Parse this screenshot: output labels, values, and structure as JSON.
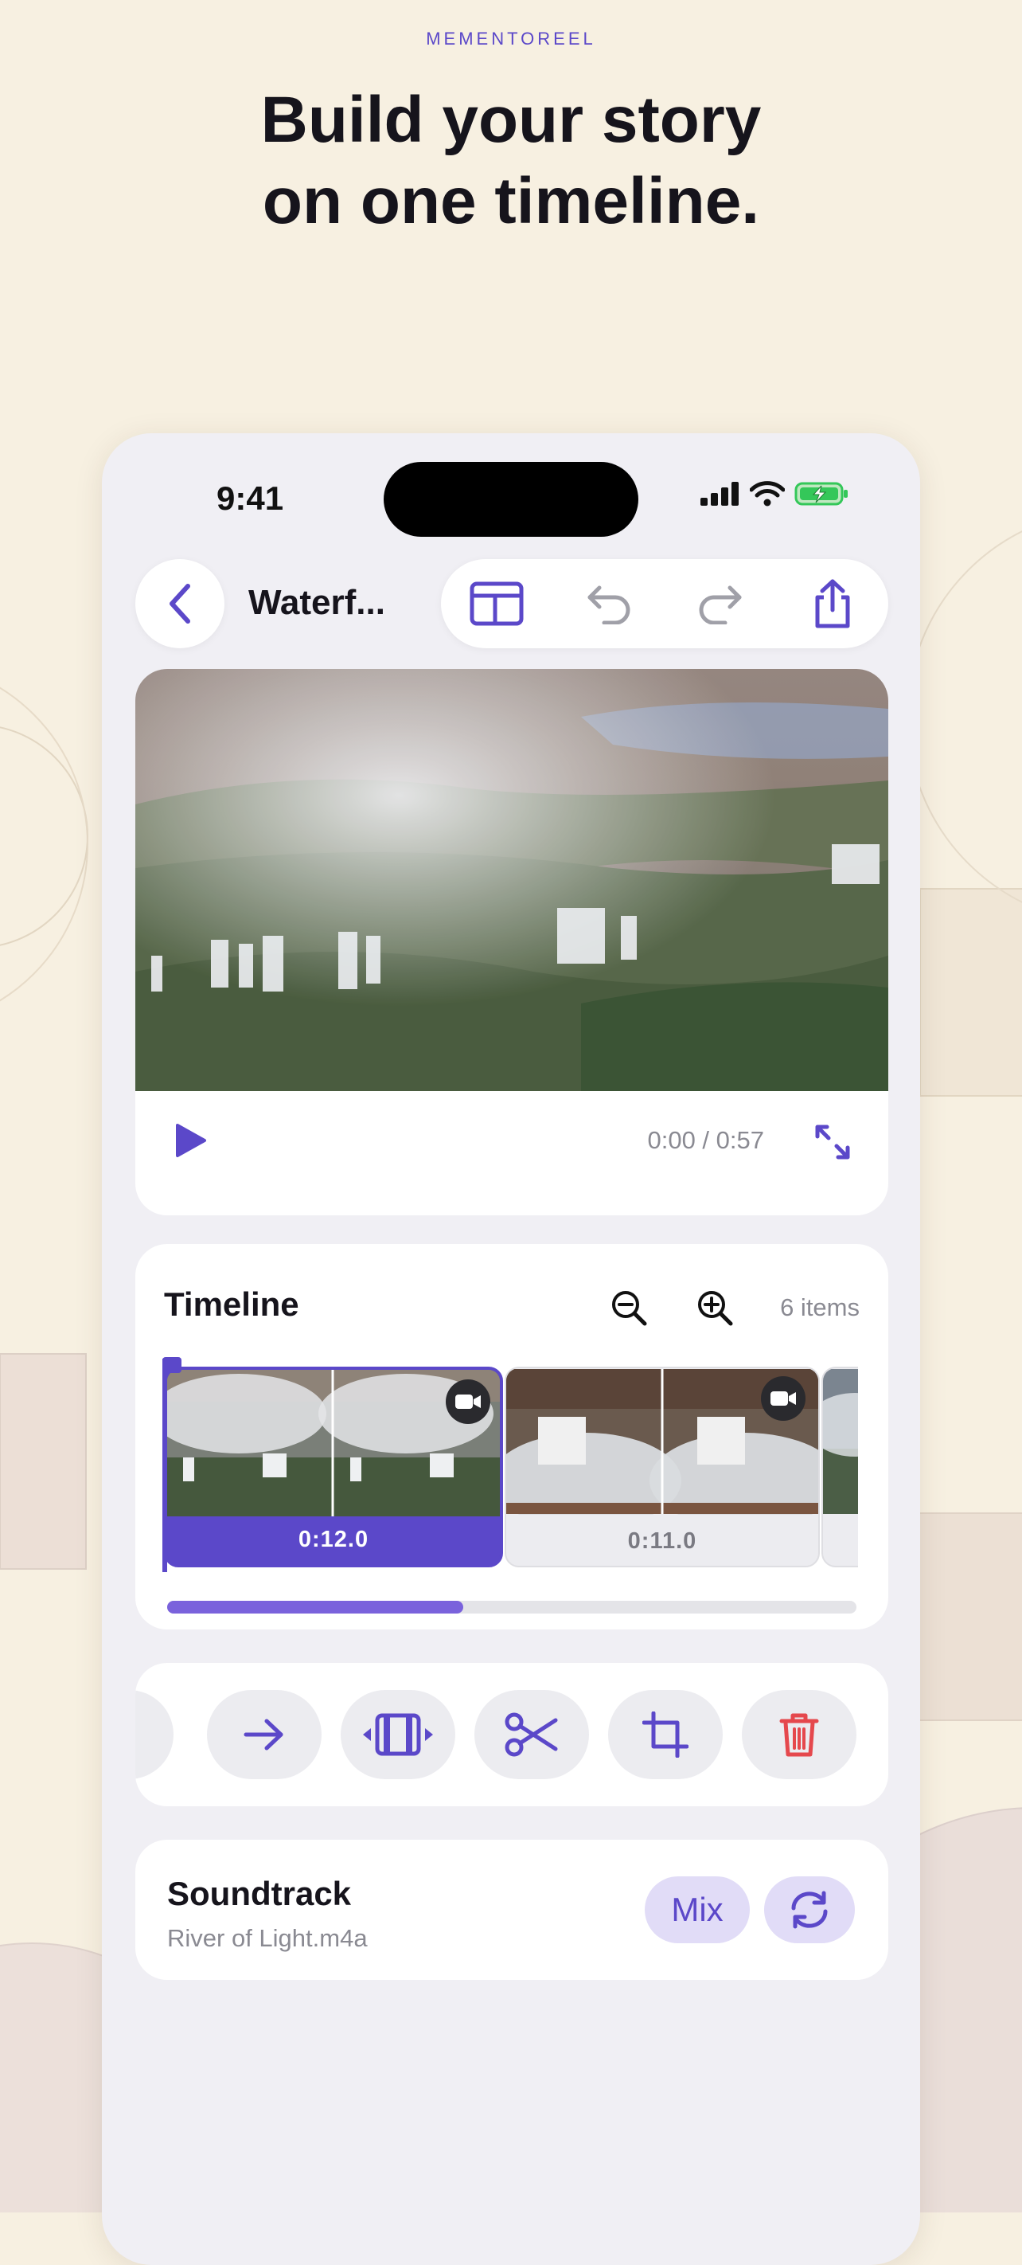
{
  "brand": "MEMENTOREEL",
  "headline": {
    "line1": "Build your story",
    "line2": "on one timeline."
  },
  "status_bar": {
    "time": "9:41",
    "icons": [
      "signal-icon",
      "wifi-icon",
      "battery-charging-icon"
    ]
  },
  "editor_header": {
    "project_title": "Waterf...",
    "back_icon": "chevron-left-icon",
    "toolbar_icons": [
      "layout-icon",
      "undo-icon",
      "redo-icon",
      "share-icon"
    ]
  },
  "preview": {
    "image": "aerial waterfalls with mist and forest",
    "timecode": "0:00 / 0:57",
    "play_icon": "play-icon",
    "expand_icon": "expand-icon"
  },
  "timeline": {
    "title": "Timeline",
    "items_count": "6 items",
    "zoom_icons": [
      "zoom-out-icon",
      "zoom-in-icon"
    ],
    "clips": [
      {
        "duration": "0:12.0",
        "selected": true,
        "type": "video"
      },
      {
        "duration": "0:11.0",
        "selected": false,
        "type": "video"
      }
    ],
    "scrub_progress": 0.43
  },
  "tools": [
    "arrow-right-icon",
    "trim-icon",
    "scissors-icon",
    "crop-icon",
    "trash-icon"
  ],
  "soundtrack": {
    "title": "Soundtrack",
    "file": "River of Light.m4a",
    "mix_label": "Mix",
    "loop_icon": "loop-icon"
  },
  "colors": {
    "accent": "#5B48C9",
    "accent_light": "#E1DCF7",
    "danger": "#E5484D",
    "background": "#F7F0E1",
    "card": "#FFFFFF"
  }
}
